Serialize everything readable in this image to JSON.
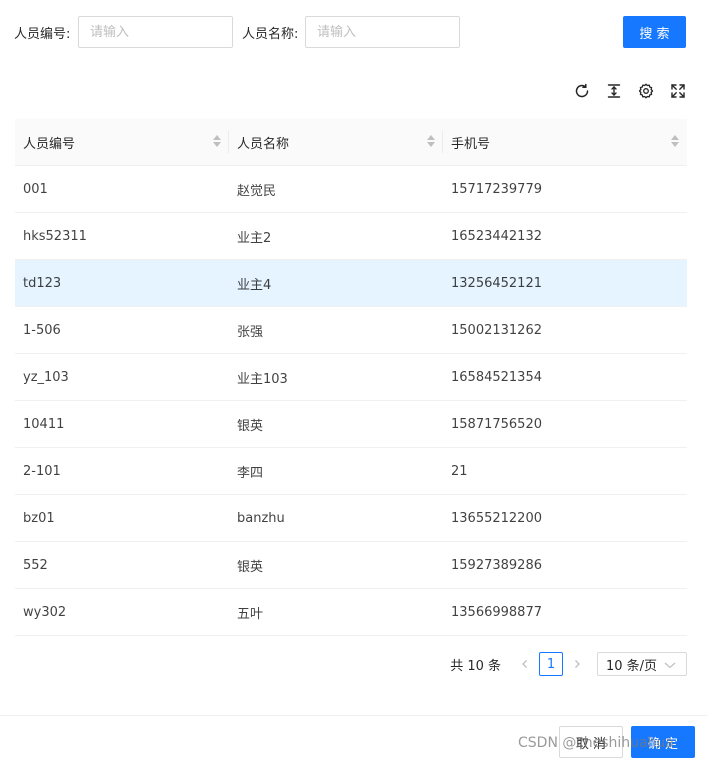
{
  "search": {
    "id_label": "人员编号:",
    "id_placeholder": "请输入",
    "name_label": "人员名称:",
    "name_placeholder": "请输入",
    "search_button": "搜 索"
  },
  "toolbar": {
    "icons": [
      "reload-icon",
      "column-height-icon",
      "setting-icon",
      "fullscreen-icon"
    ]
  },
  "table": {
    "columns": [
      "人员编号",
      "人员名称",
      "手机号"
    ],
    "selected_row_index": 2,
    "rows": [
      [
        "001",
        "赵觉民",
        "15717239779"
      ],
      [
        "hks52311",
        "业主2",
        "16523442132"
      ],
      [
        "td123",
        "业主4",
        "13256452121"
      ],
      [
        "1-506",
        "张强",
        "15002131262"
      ],
      [
        "yz_103",
        "业主103",
        "16584521354"
      ],
      [
        "10411",
        "银英",
        "15871756520"
      ],
      [
        "2-101",
        "李四",
        "21"
      ],
      [
        "bz01",
        "banzhu",
        "13655212200"
      ],
      [
        "552",
        "银英",
        "15927389286"
      ],
      [
        "wy302",
        "五叶",
        "13566998877"
      ]
    ]
  },
  "pagination": {
    "total": "共 10 条",
    "current_page": "1",
    "page_size": "10 条/页"
  },
  "footer": {
    "cancel": "取 消",
    "ok": "确 定"
  },
  "watermark": "CSDN @zheshihuahua",
  "colors": {
    "primary": "#1677ff",
    "selected_row": "#e6f4ff",
    "header_bg": "#fafafa"
  }
}
